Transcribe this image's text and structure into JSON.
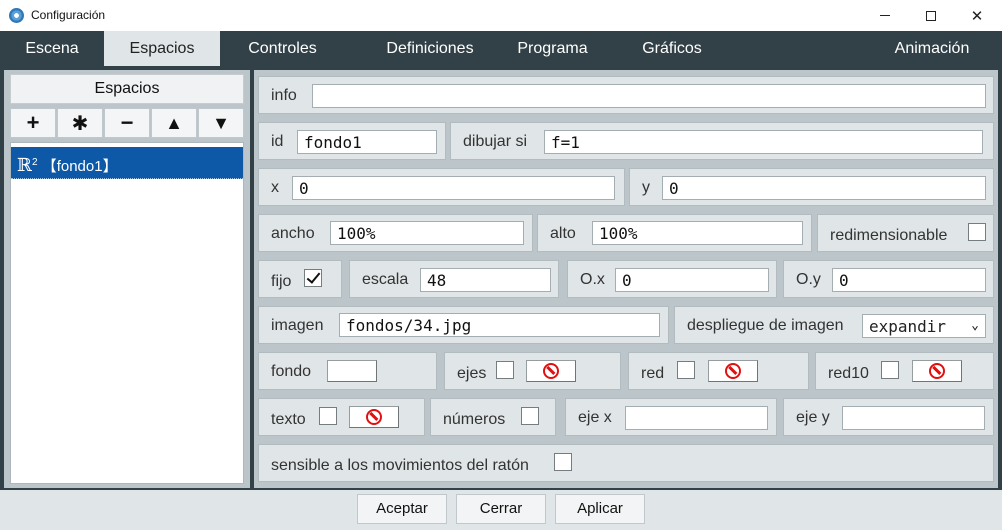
{
  "window": {
    "title": "Configuración",
    "min_glyph": "—",
    "close_glyph": "✕"
  },
  "menu": {
    "tabs": [
      "Escena",
      "Espacios",
      "Controles",
      "Definiciones",
      "Programa",
      "Gráficos",
      "Animación"
    ],
    "active": "Espacios"
  },
  "left": {
    "header": "Espacios",
    "toolbar": {
      "add": "+",
      "copy": "✱",
      "remove": "−",
      "up": "▲",
      "down": "▼"
    },
    "items": [
      {
        "symbol": "ℝ",
        "superscript": "2",
        "label": "【fondo1】"
      }
    ]
  },
  "form": {
    "info": {
      "label": "info",
      "value": ""
    },
    "id": {
      "label": "id",
      "value": "fondo1"
    },
    "draw_if": {
      "label": "dibujar si",
      "value": "f=1"
    },
    "x": {
      "label": "x",
      "value": "0"
    },
    "y": {
      "label": "y",
      "value": "0"
    },
    "width": {
      "label": "ancho",
      "value": "100%"
    },
    "height": {
      "label": "alto",
      "value": "100%"
    },
    "resizable": {
      "label": "redimensionable",
      "checked": false
    },
    "fixed": {
      "label": "fijo",
      "checked": true
    },
    "scale": {
      "label": "escala",
      "value": "48"
    },
    "ox": {
      "label": "O.x",
      "value": "0"
    },
    "oy": {
      "label": "O.y",
      "value": "0"
    },
    "image": {
      "label": "imagen",
      "value": "fondos/34.jpg"
    },
    "image_display": {
      "label": "despliegue de imagen",
      "value": "expandir"
    },
    "background": {
      "label": "fondo",
      "color": "#ffffff"
    },
    "axes": {
      "label": "ejes",
      "checked": false
    },
    "grid": {
      "label": "red",
      "checked": false
    },
    "grid10": {
      "label": "red10",
      "checked": false
    },
    "text": {
      "label": "texto",
      "checked": false
    },
    "numbers": {
      "label": "números",
      "checked": false
    },
    "x_axis": {
      "label": "eje x",
      "value": ""
    },
    "y_axis": {
      "label": "eje y",
      "value": ""
    },
    "mouse_sensitive": {
      "label": "sensible a los movimientos del ratón",
      "checked": false
    }
  },
  "buttons": {
    "accept": "Aceptar",
    "close": "Cerrar",
    "apply": "Aplicar"
  },
  "colors": {
    "menubar": "#324148",
    "panel": "#bcc6ca",
    "cell": "#e0e5e7",
    "selection": "#0d58a7",
    "no_color": "#e01010"
  },
  "icons": {
    "app": "app-circle-icon",
    "no_color": "no-entry-icon",
    "dropdown": "chevron-down-icon"
  }
}
